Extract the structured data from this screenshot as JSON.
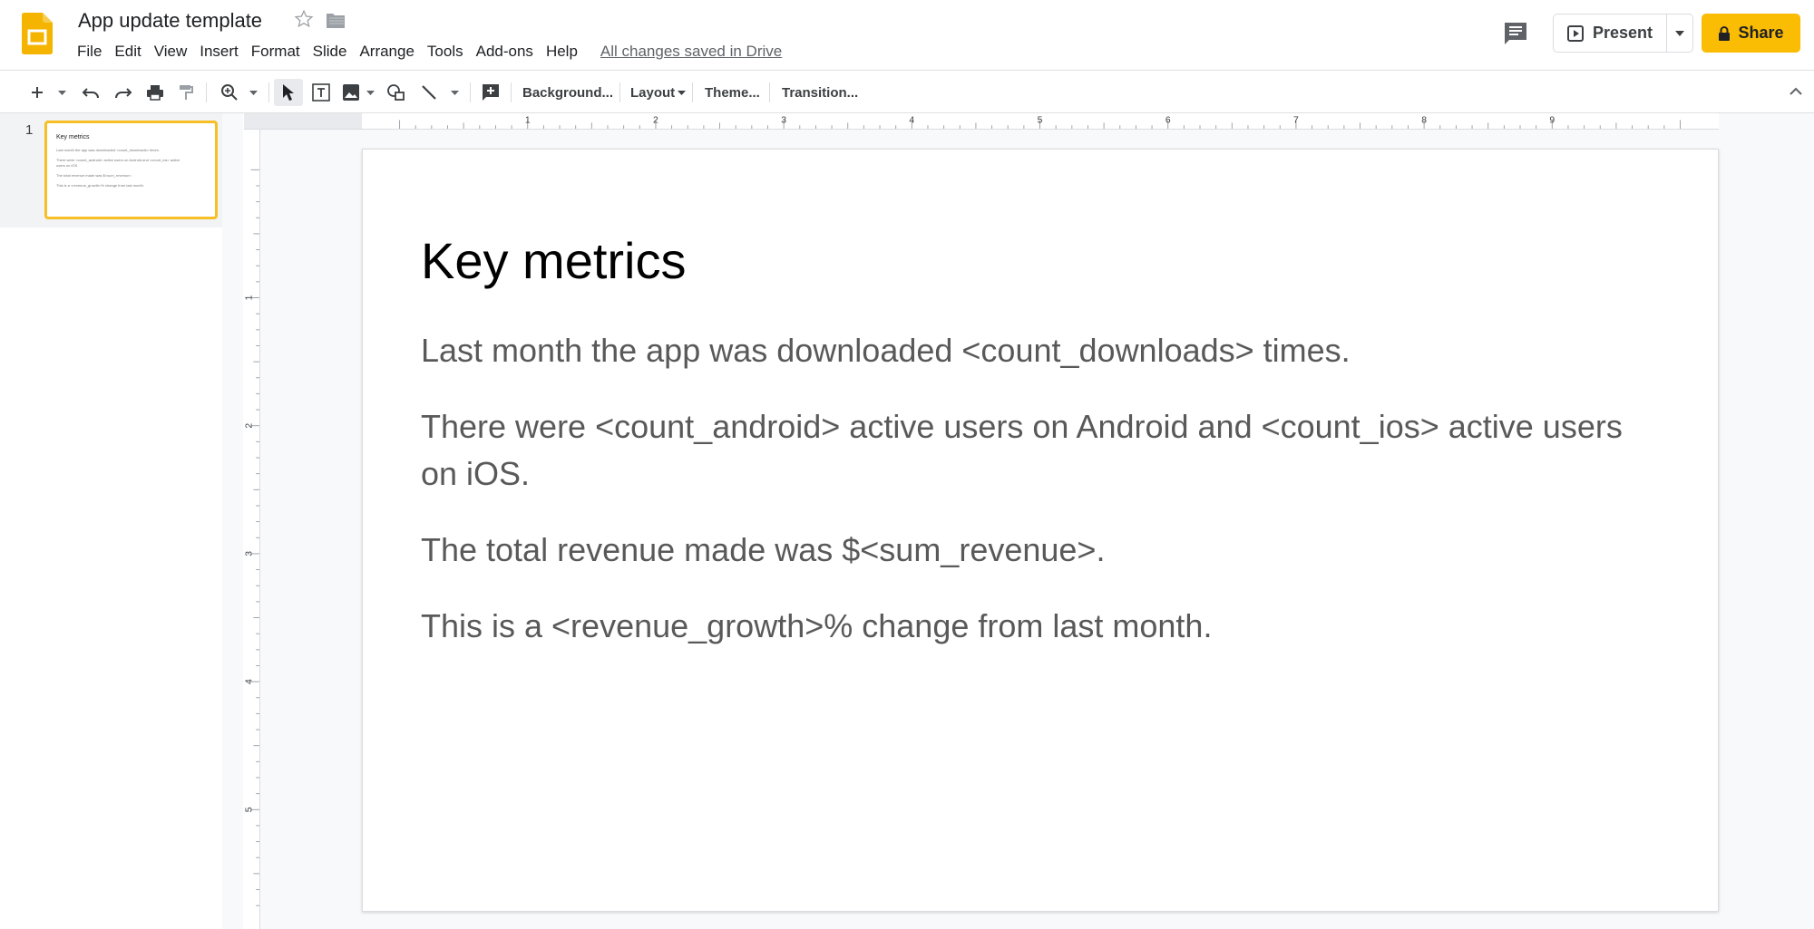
{
  "header": {
    "doc_title": "App update template",
    "save_status": "All changes saved in Drive",
    "menu": [
      "File",
      "Edit",
      "View",
      "Insert",
      "Format",
      "Slide",
      "Arrange",
      "Tools",
      "Add-ons",
      "Help"
    ],
    "present_label": "Present",
    "share_label": "Share",
    "brand_color": "#fbbc04"
  },
  "toolbar": {
    "background_label": "Background...",
    "layout_label": "Layout",
    "theme_label": "Theme...",
    "transition_label": "Transition...",
    "icons": [
      "new-slide-icon",
      "undo-icon",
      "redo-icon",
      "print-icon",
      "paint-format-icon",
      "zoom-icon",
      "select-icon",
      "text-box-icon",
      "image-icon",
      "shape-icon",
      "line-icon",
      "comment-add-icon"
    ]
  },
  "filmstrip": {
    "slides": [
      {
        "number": "1",
        "title": "Key metrics",
        "lines": [
          "Last month the app was downloaded <count_downloads> times.",
          "There were <count_android> active users on Android and <count_ios> active",
          "users on iOS.",
          "The total revenue made was $<sum_revenue>.",
          "This is a <revenue_growth>% change from last month."
        ]
      }
    ]
  },
  "ruler": {
    "h_labels": [
      "1",
      "2",
      "3",
      "4",
      "5",
      "6",
      "7",
      "8",
      "9"
    ],
    "v_labels": [
      "1",
      "2",
      "3",
      "4",
      "5"
    ]
  },
  "slide": {
    "title": "Key metrics",
    "paragraphs": [
      "Last month the app was downloaded <count_downloads> times.",
      "There were <count_android> active users on Android and <count_ios> active users on iOS.",
      "The total revenue made was $<sum_revenue>.",
      "This is a <revenue_growth>% change from last month."
    ]
  }
}
